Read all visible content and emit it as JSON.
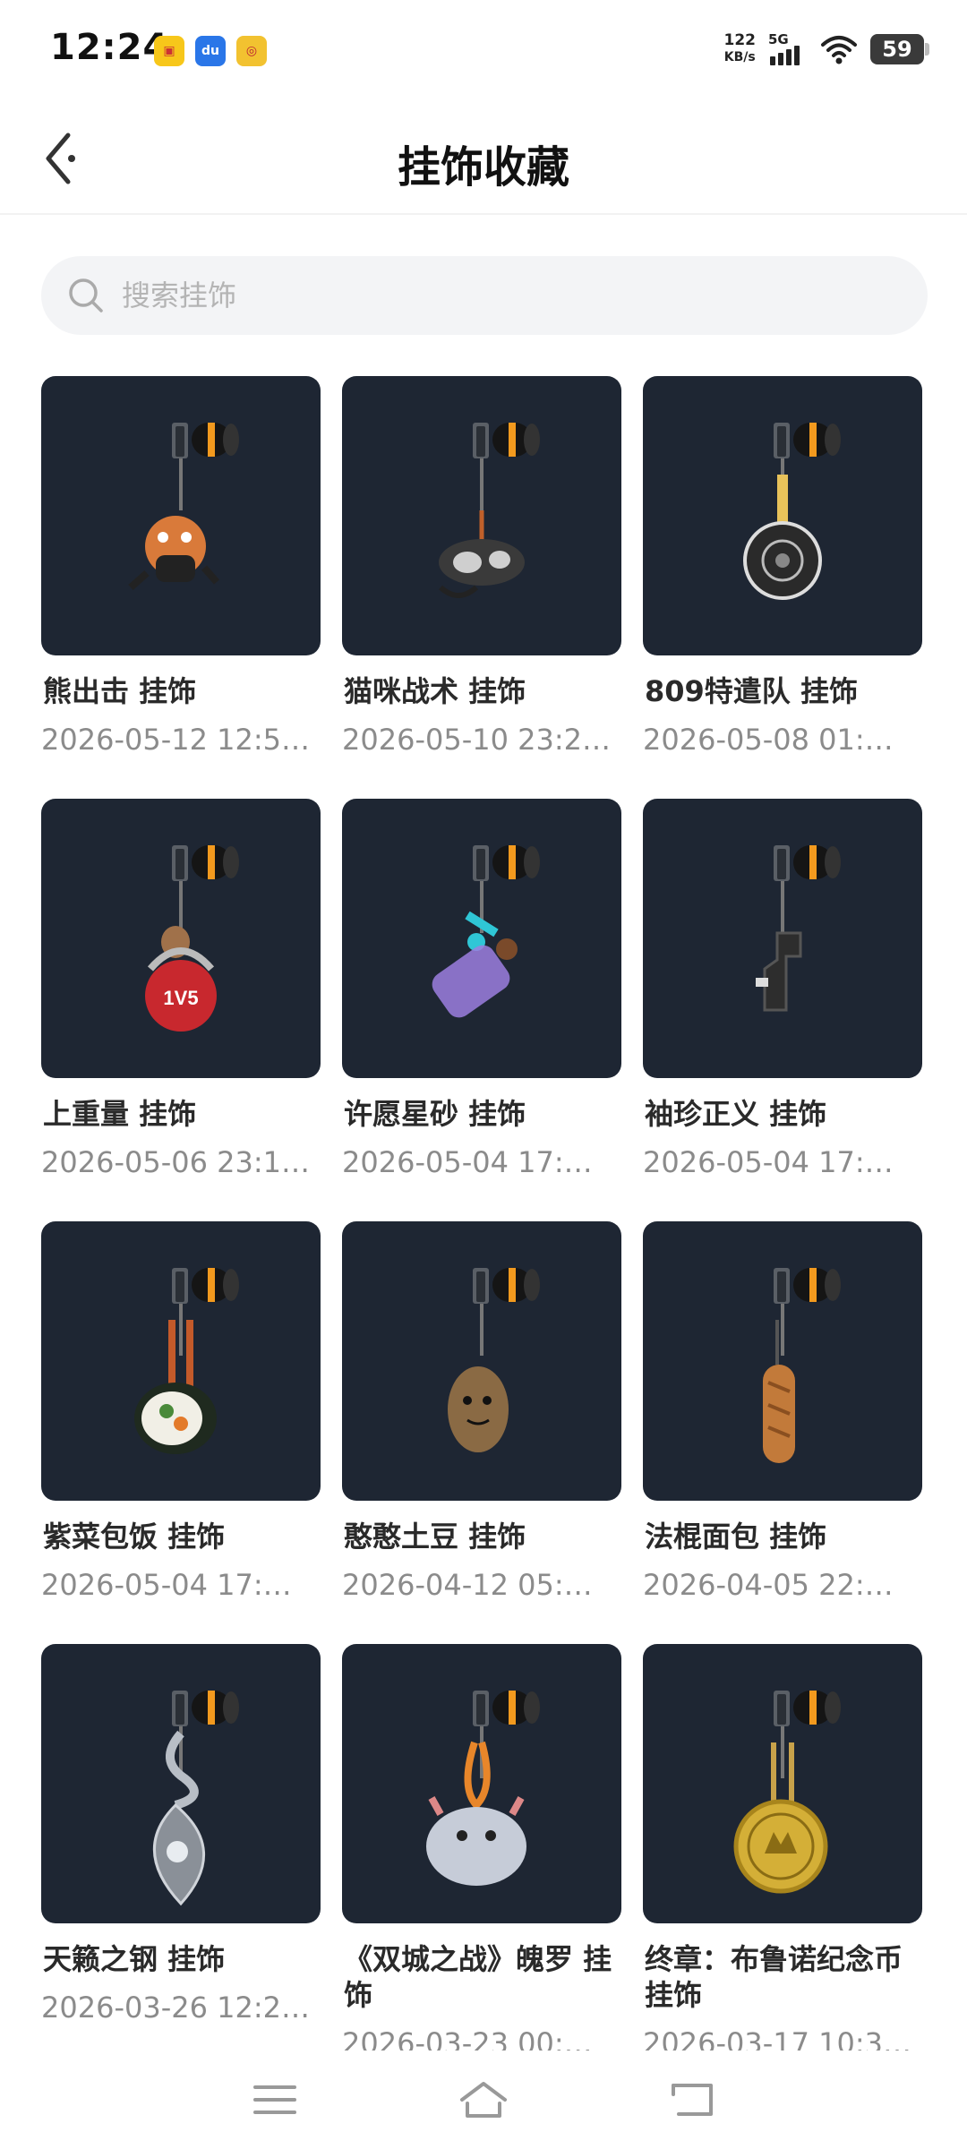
{
  "status_bar": {
    "time": "12:24",
    "net_speed_value": "122",
    "net_speed_unit": "KB/s",
    "network_type": "5G",
    "battery": "59",
    "app_icons": [
      "notification-app-icon",
      "du-app-icon",
      "target-app-icon"
    ]
  },
  "header": {
    "title": "挂饰收藏"
  },
  "search": {
    "placeholder": "搜索挂饰",
    "value": ""
  },
  "items": [
    {
      "title": "熊出击 挂饰",
      "date": "2026-05-12 12:5…",
      "icon": "bear-charm-icon",
      "accent": "#d97a3a"
    },
    {
      "title": " 猫咪战术 挂饰",
      "date": "2026-05-10 23:2…",
      "icon": "cat-charm-icon",
      "accent": "#cfcfcf"
    },
    {
      "title": " 809特遣队 挂饰",
      "date": "2026-05-08 01:…",
      "icon": "disc-charm-icon",
      "accent": "#e8c25a"
    },
    {
      "title": " 上重量 挂饰",
      "date": "2026-05-06 23:1…",
      "icon": "kettlebell-charm-icon",
      "accent": "#c8282e"
    },
    {
      "title": "许愿星砂 挂饰",
      "date": "2026-05-04 17:…",
      "icon": "wish-bottle-charm-icon",
      "accent": "#9c7fe0"
    },
    {
      "title": " 袖珍正义 挂饰",
      "date": "2026-05-04 17:…",
      "icon": "pistol-charm-icon",
      "accent": "#2d2d2d"
    },
    {
      "title": " 紫菜包饭 挂饰",
      "date": "2026-05-04 17:…",
      "icon": "sushi-charm-icon",
      "accent": "#4a8a3a"
    },
    {
      "title": "憨憨土豆 挂饰",
      "date": "2026-04-12 05:…",
      "icon": "potato-charm-icon",
      "accent": "#8a6a44"
    },
    {
      "title": "法棍面包 挂饰",
      "date": "2026-04-05 22:…",
      "icon": "baguette-charm-icon",
      "accent": "#c27a3a"
    },
    {
      "title": "天籁之钢 挂饰",
      "date": "2026-03-26 12:2…",
      "icon": "steel-blade-charm-icon",
      "accent": "#b8bec6"
    },
    {
      "title": "《双城之战》魄罗 挂饰",
      "date": "2026-03-23 00:…",
      "icon": "poro-charm-icon",
      "accent": "#c6ccd8"
    },
    {
      "title": "终章：布鲁诺纪念币 挂饰",
      "date": "2026-03-17 10:3…",
      "icon": "coin-charm-icon",
      "accent": "#d4af37"
    }
  ],
  "nav_bar": {
    "buttons": [
      "menu-icon",
      "home-icon",
      "back-icon"
    ]
  }
}
